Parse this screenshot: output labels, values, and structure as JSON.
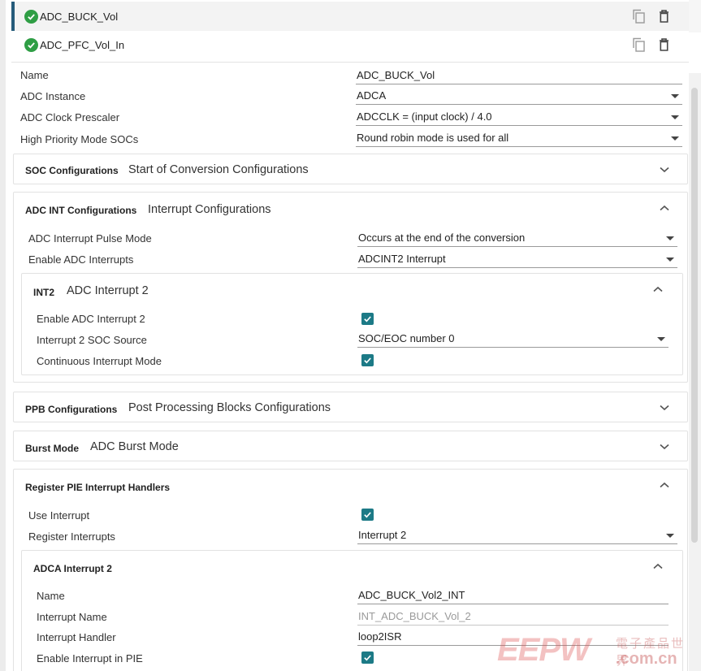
{
  "items": [
    {
      "name": "ADC_BUCK_Vol",
      "status": "valid",
      "selected": true
    },
    {
      "name": "ADC_PFC_Vol_In",
      "status": "valid",
      "selected": false
    }
  ],
  "config": {
    "name_label": "Name",
    "name_value": "ADC_BUCK_Vol",
    "instance_label": "ADC Instance",
    "instance_value": "ADCA",
    "prescaler_label": "ADC Clock Prescaler",
    "prescaler_value": "ADCCLK = (input clock) / 4.0",
    "priority_label": "High Priority Mode SOCs",
    "priority_value": "Round robin mode is used for all"
  },
  "soc": {
    "title": "SOC Configurations",
    "subtitle": "Start of Conversion Configurations"
  },
  "adc_int": {
    "title": "ADC INT Configurations",
    "subtitle": "Interrupt Configurations",
    "pulse_label": "ADC Interrupt Pulse Mode",
    "pulse_value": "Occurs at the end of the conversion",
    "enable_label": "Enable ADC Interrupts",
    "enable_value": "ADCINT2 Interrupt",
    "int2": {
      "title": "INT2",
      "subtitle": "ADC Interrupt 2",
      "enable_label": "Enable ADC Interrupt 2",
      "soc_label": "Interrupt 2 SOC Source",
      "soc_value": "SOC/EOC number 0",
      "continuous_label": "Continuous Interrupt Mode"
    }
  },
  "ppb": {
    "title": "PPB Configurations",
    "subtitle": "Post Processing Blocks Configurations"
  },
  "burst": {
    "title": "Burst Mode",
    "subtitle": "ADC Burst Mode"
  },
  "pie": {
    "title": "Register PIE Interrupt Handlers",
    "use_label": "Use Interrupt",
    "register_label": "Register Interrupts",
    "register_value": "Interrupt 2",
    "adca": {
      "title": "ADCA Interrupt 2",
      "name_label": "Name",
      "name_value": "ADC_BUCK_Vol2_INT",
      "int_name_label": "Interrupt Name",
      "int_name_value": "INT_ADC_BUCK_Vol_2",
      "handler_label": "Interrupt Handler",
      "handler_value": "loop2ISR",
      "enable_pie_label": "Enable Interrupt in PIE"
    }
  },
  "checkboxes": {
    "enable_int2": true,
    "continuous": true,
    "use_interrupt": true,
    "enable_pie": true
  },
  "watermark": {
    "main": "EEPW",
    "sub": "電子產品世界",
    "url": ".com.cn"
  },
  "colors": {
    "accent": "#1c7a86",
    "valid": "#2f9e45",
    "selected_bar": "#255b7a"
  }
}
